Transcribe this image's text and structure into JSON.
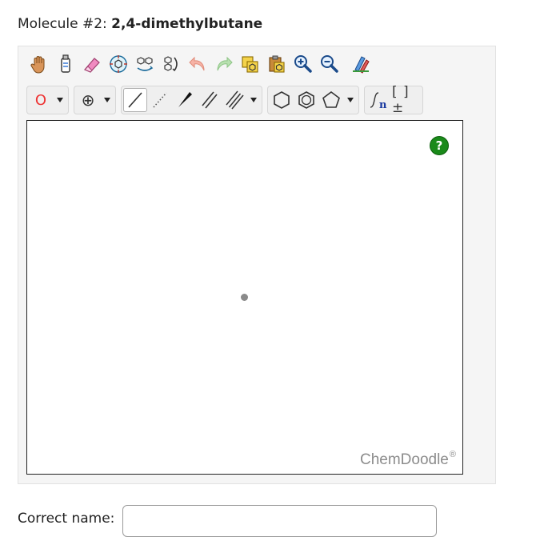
{
  "question": {
    "prefix": "Molecule #2:",
    "molecule_name": "2,4-dimethylbutane"
  },
  "toolbar_row1": {
    "icons": [
      "hand-icon",
      "lasso-icon",
      "eraser-icon",
      "center-icon",
      "flip-icon",
      "rotate-icon",
      "undo-icon",
      "redo-icon",
      "copy-icon",
      "paste-icon",
      "zoom-in-icon",
      "zoom-out-icon",
      "clean-icon"
    ]
  },
  "toolbar_row2": {
    "element_symbol": "O",
    "charge_symbol": "⊕",
    "bracket_symbol": "[ ]±"
  },
  "canvas": {
    "help_label": "?",
    "watermark": "ChemDoodle",
    "watermark_mark": "®"
  },
  "answer": {
    "label": "Correct name:",
    "value": "",
    "placeholder": ""
  },
  "colors": {
    "help_green": "#1a8a1a",
    "element_red": "#e33333",
    "watermark_gray": "#8c8c8c"
  }
}
